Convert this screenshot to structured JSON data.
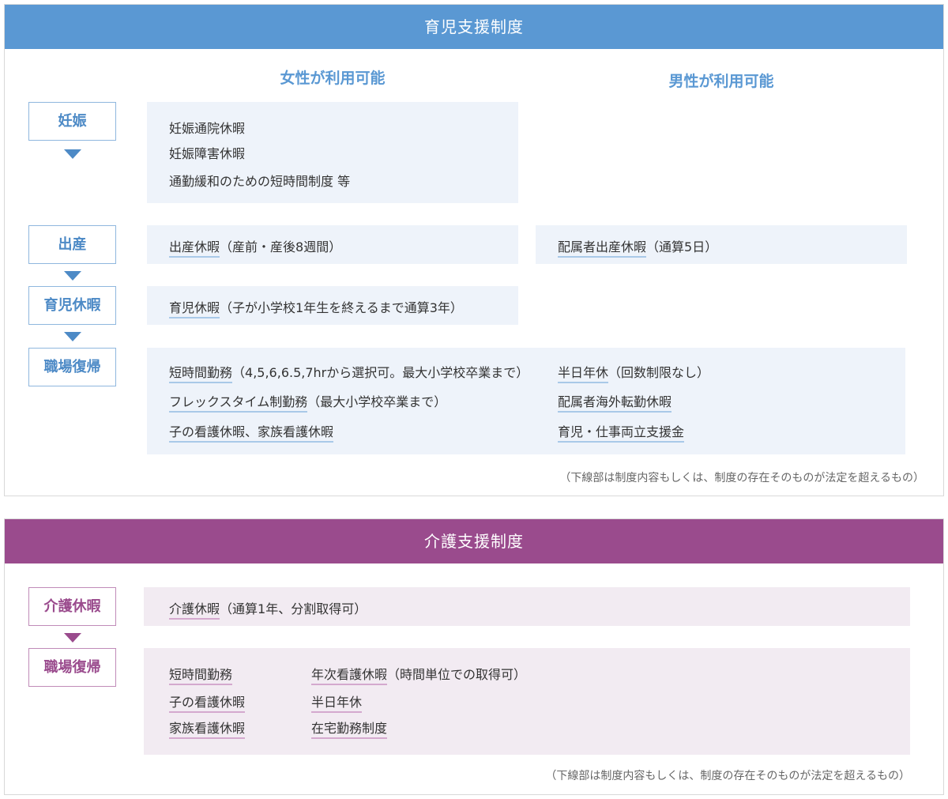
{
  "childcare": {
    "title": "育児支援制度",
    "col_women": "女性が利用可能",
    "col_men": "男性が利用可能",
    "stages": {
      "pregnancy": "妊娠",
      "birth": "出産",
      "leave": "育児休暇",
      "return": "職場復帰"
    },
    "pregnancy_items": [
      "妊娠通院休暇",
      "妊娠障害休暇",
      "通勤緩和のための短時間制度 等"
    ],
    "birth_women": {
      "underlined": "出産休暇",
      "rest": "（産前・産後8週間）"
    },
    "birth_men": {
      "underlined": "配属者出産休暇",
      "rest": "（通算5日）"
    },
    "leave_women": {
      "underlined": "育児休暇",
      "rest": "（子が小学校1年生を終えるまで通算3年）"
    },
    "return_left": [
      {
        "underlined": "短時間勤務",
        "rest": "（4,5,6,6.5,7hrから選択可。最大小学校卒業まで）"
      },
      {
        "underlined": "フレックスタイム制勤務",
        "rest": "（最大小学校卒業まで）"
      },
      {
        "underlined": "子の看護休暇、家族看護休暇",
        "rest": ""
      }
    ],
    "return_right": [
      {
        "underlined": "半日年休",
        "rest": "（回数制限なし）"
      },
      {
        "underlined": "配属者海外転勤休暇",
        "rest": ""
      },
      {
        "underlined": "育児・仕事両立支援金",
        "rest": ""
      }
    ],
    "note": "（下線部は制度内容もしくは、制度の存在そのものが法定を超えるもの）"
  },
  "nursing": {
    "title": "介護支援制度",
    "stages": {
      "leave": "介護休暇",
      "return": "職場復帰"
    },
    "leave_item": {
      "underlined": "介護休暇",
      "rest": "（通算1年、分割取得可）"
    },
    "return_left": [
      "短時間勤務",
      "子の看護休暇",
      "家族看護休暇"
    ],
    "return_right": [
      {
        "underlined": "年次看護休暇",
        "rest": "（時間単位での取得可）"
      },
      {
        "underlined": "半日年休",
        "rest": ""
      },
      {
        "underlined": "在宅勤務制度",
        "rest": ""
      }
    ],
    "note": "（下線部は制度内容もしくは、制度の存在そのものが法定を超えるもの）"
  },
  "colors": {
    "childcare_accent": "#5a98d3",
    "nursing_accent": "#9a4b8d",
    "childcare_box": "#eef3fa",
    "nursing_box": "#f2ebf2"
  }
}
